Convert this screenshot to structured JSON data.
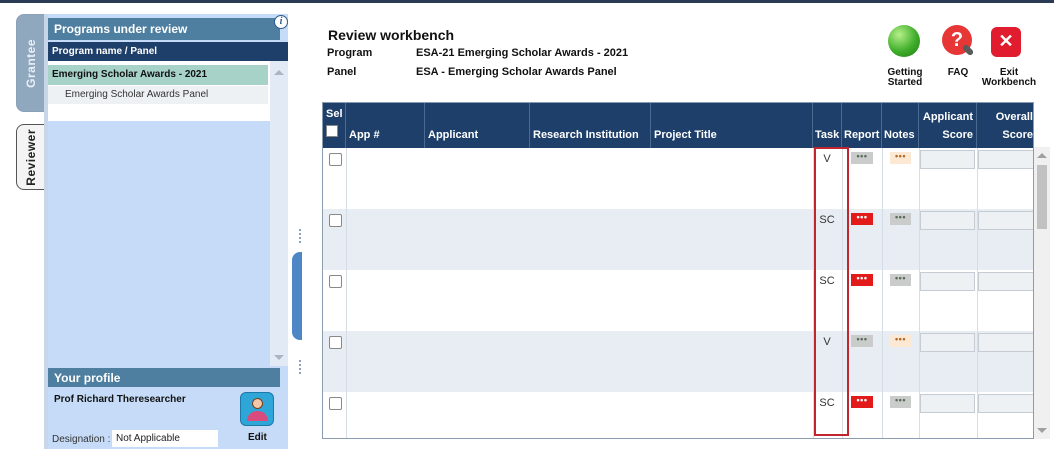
{
  "tabs": {
    "grantee": "Grantee",
    "reviewer": "Reviewer"
  },
  "left_panel": {
    "header": "Programs under review",
    "column_header": "Program name / Panel",
    "program": "Emerging Scholar Awards - 2021",
    "panel": "Emerging Scholar Awards Panel"
  },
  "profile": {
    "header": "Your profile",
    "name": "Prof Richard Theresearcher",
    "edit_label": "Edit",
    "designation_label": "Designation :",
    "designation_value": "Not Applicable"
  },
  "workbench": {
    "title": "Review workbench",
    "program_label": "Program",
    "program_value": "ESA-21 Emerging Scholar Awards - 2021",
    "panel_label": "Panel",
    "panel_value": "ESA - Emerging Scholar Awards Panel"
  },
  "toolbar": {
    "getting_started_line1": "Getting",
    "getting_started_line2": "Started",
    "faq": "FAQ",
    "exit_line1": "Exit",
    "exit_line2": "Workbench"
  },
  "icons": {
    "info": "info-icon",
    "faq_glyph": "?",
    "exit_glyph": "✕",
    "dots": "•••"
  },
  "grid": {
    "headers": {
      "sel": "Sel",
      "app_no": "App #",
      "applicant": "Applicant",
      "institution": "Research Institution",
      "project": "Project Title",
      "task": "Task",
      "report": "Report",
      "notes": "Notes",
      "applicant_score_line1": "Applicant",
      "applicant_score_line2": "Score",
      "overall_score_line1": "Overall",
      "overall_score_line2": "Score"
    },
    "rows": [
      {
        "task": "V",
        "report_status": "gray",
        "notes_status": "beige"
      },
      {
        "task": "SC",
        "report_status": "red",
        "notes_status": "gray"
      },
      {
        "task": "SC",
        "report_status": "red",
        "notes_status": "gray"
      },
      {
        "task": "V",
        "report_status": "gray",
        "notes_status": "beige"
      },
      {
        "task": "SC",
        "report_status": "red",
        "notes_status": "gray"
      }
    ]
  },
  "colors": {
    "header_navy": "#1e3f6a",
    "panel_blue": "#c5dbf7",
    "highlight_red": "#c0262d",
    "status_red": "#e21a1a"
  }
}
